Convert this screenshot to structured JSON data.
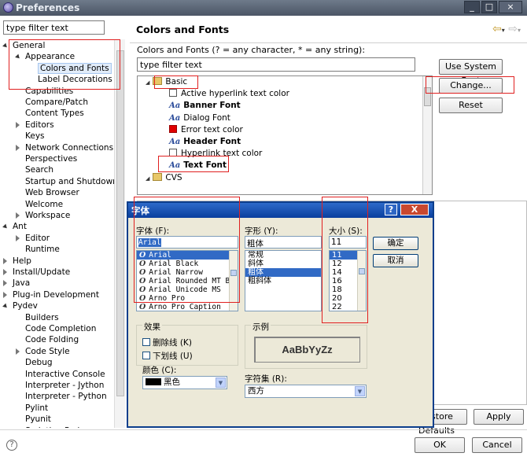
{
  "window": {
    "title": "Preferences",
    "min_label": "_",
    "max_label": "□",
    "close_label": "×"
  },
  "left": {
    "filter_value": "type filter text",
    "tree": [
      {
        "label": "General",
        "depth": 0,
        "expander": "down"
      },
      {
        "label": "Appearance",
        "depth": 1,
        "expander": "down"
      },
      {
        "label": "Colors and Fonts",
        "depth": 2,
        "expander": "none",
        "selected": true
      },
      {
        "label": "Label Decorations",
        "depth": 2,
        "expander": "none"
      },
      {
        "label": "Capabilities",
        "depth": 1,
        "expander": "none"
      },
      {
        "label": "Compare/Patch",
        "depth": 1,
        "expander": "none"
      },
      {
        "label": "Content Types",
        "depth": 1,
        "expander": "none"
      },
      {
        "label": "Editors",
        "depth": 1,
        "expander": "right"
      },
      {
        "label": "Keys",
        "depth": 1,
        "expander": "none"
      },
      {
        "label": "Network Connections",
        "depth": 1,
        "expander": "right"
      },
      {
        "label": "Perspectives",
        "depth": 1,
        "expander": "none"
      },
      {
        "label": "Search",
        "depth": 1,
        "expander": "none"
      },
      {
        "label": "Startup and Shutdown",
        "depth": 1,
        "expander": "none"
      },
      {
        "label": "Web Browser",
        "depth": 1,
        "expander": "none"
      },
      {
        "label": "Welcome",
        "depth": 1,
        "expander": "none"
      },
      {
        "label": "Workspace",
        "depth": 1,
        "expander": "right"
      },
      {
        "label": "Ant",
        "depth": 0,
        "expander": "down"
      },
      {
        "label": "Editor",
        "depth": 1,
        "expander": "right"
      },
      {
        "label": "Runtime",
        "depth": 1,
        "expander": "none"
      },
      {
        "label": "Help",
        "depth": 0,
        "expander": "right"
      },
      {
        "label": "Install/Update",
        "depth": 0,
        "expander": "right"
      },
      {
        "label": "Java",
        "depth": 0,
        "expander": "right"
      },
      {
        "label": "Plug-in Development",
        "depth": 0,
        "expander": "right"
      },
      {
        "label": "Pydev",
        "depth": 0,
        "expander": "down"
      },
      {
        "label": "Builders",
        "depth": 1,
        "expander": "none"
      },
      {
        "label": "Code Completion",
        "depth": 1,
        "expander": "none"
      },
      {
        "label": "Code Folding",
        "depth": 1,
        "expander": "none"
      },
      {
        "label": "Code Style",
        "depth": 1,
        "expander": "right"
      },
      {
        "label": "Debug",
        "depth": 1,
        "expander": "none"
      },
      {
        "label": "Interactive Console",
        "depth": 1,
        "expander": "none"
      },
      {
        "label": "Interpreter - Jython",
        "depth": 1,
        "expander": "none"
      },
      {
        "label": "Interpreter - Python",
        "depth": 1,
        "expander": "none"
      },
      {
        "label": "Pylint",
        "depth": 1,
        "expander": "none"
      },
      {
        "label": "Pyunit",
        "depth": 1,
        "expander": "none"
      },
      {
        "label": "Scripting Pydev",
        "depth": 1,
        "expander": "none"
      }
    ]
  },
  "right": {
    "title": "Colors and Fonts",
    "description": "Colors and Fonts (? = any character, * = any string):",
    "filter_value": "type filter text",
    "list": [
      {
        "kind": "folder",
        "label": "Basic"
      },
      {
        "kind": "check",
        "label": "Active hyperlink text color"
      },
      {
        "kind": "font",
        "label": "Banner Font",
        "bold": true
      },
      {
        "kind": "font",
        "label": "Dialog Font"
      },
      {
        "kind": "red",
        "label": "Error text color"
      },
      {
        "kind": "font",
        "label": "Header Font",
        "bold": true
      },
      {
        "kind": "check",
        "label": "Hyperlink text color"
      },
      {
        "kind": "font",
        "label": "Text Font",
        "bold": true
      },
      {
        "kind": "folder",
        "label": "CVS"
      }
    ],
    "font_icon_label": "Aa",
    "buttons": {
      "use_system_font": "Use System Font",
      "change": "Change...",
      "reset": "Reset",
      "restore_defaults": "Restore Defaults",
      "apply": "Apply"
    }
  },
  "font_dialog": {
    "title": "字体",
    "help_label": "?",
    "close_label": "X",
    "font_label": "字体 (F):",
    "font_value": "Arial",
    "fonts": [
      "Arial",
      "Arial Black",
      "Arial Narrow",
      "Arial Rounded MT B",
      "Arial Unicode MS",
      "Arno Pro",
      "Arno Pro Caption"
    ],
    "font_glyph": "O",
    "style_label": "字形 (Y):",
    "style_value": "粗体",
    "styles": [
      "常规",
      "斜体",
      "粗体",
      "粗斜体"
    ],
    "size_label": "大小 (S):",
    "size_value": "11",
    "sizes": [
      "11",
      "12",
      "14",
      "16",
      "18",
      "20",
      "22"
    ],
    "ok": "确定",
    "cancel": "取消",
    "effects_label": "效果",
    "strikeout_label": "删除线 (K)",
    "underline_label": "下划线 (U)",
    "color_label": "颜色 (C):",
    "color_value": "黑色",
    "sample_label": "示例",
    "sample_text": "AaBbYyZz",
    "charset_label": "字符集 (R):",
    "charset_value": "西方"
  },
  "bottom": {
    "help_icon": "?",
    "ok": "OK",
    "cancel": "Cancel"
  }
}
